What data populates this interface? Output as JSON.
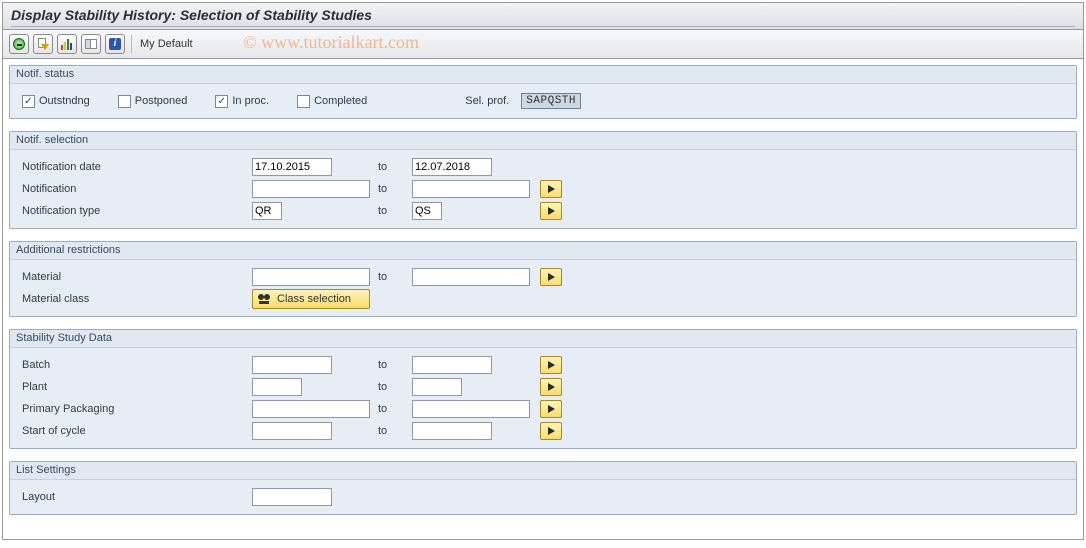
{
  "title": "Display Stability History: Selection of Stability Studies",
  "toolbar": {
    "my_default": "My Default"
  },
  "watermark": "© www.tutorialkart.com",
  "status_group": {
    "title": "Notif. status",
    "outstanding_label": "Outstndng",
    "outstanding_checked": "✓",
    "postponed_label": "Postponed",
    "postponed_checked": "",
    "inproc_label": "In proc.",
    "inproc_checked": "✓",
    "completed_label": "Completed",
    "completed_checked": "",
    "sel_prof_label": "Sel. prof.",
    "sel_prof_value": "SAPQSTH"
  },
  "notif_sel": {
    "title": "Notif. selection",
    "date_label": "Notification date",
    "date_from": "17.10.2015",
    "date_to": "12.07.2018",
    "to_label": "to",
    "notif_label": "Notification",
    "notif_from": "",
    "notif_to": "",
    "type_label": "Notification type",
    "type_from": "QR",
    "type_to": "QS"
  },
  "add_restr": {
    "title": "Additional restrictions",
    "material_label": "Material",
    "material_from": "",
    "material_to": "",
    "to_label": "to",
    "matclass_label": "Material class",
    "class_sel_label": "Class selection"
  },
  "stab_data": {
    "title": "Stability Study Data",
    "to_label": "to",
    "batch_label": "Batch",
    "batch_from": "",
    "batch_to": "",
    "plant_label": "Plant",
    "plant_from": "",
    "plant_to": "",
    "primpack_label": "Primary Packaging",
    "primpack_from": "",
    "primpack_to": "",
    "cycle_label": "Start of cycle",
    "cycle_from": "",
    "cycle_to": ""
  },
  "list_settings": {
    "title": "List Settings",
    "layout_label": "Layout",
    "layout_value": ""
  }
}
